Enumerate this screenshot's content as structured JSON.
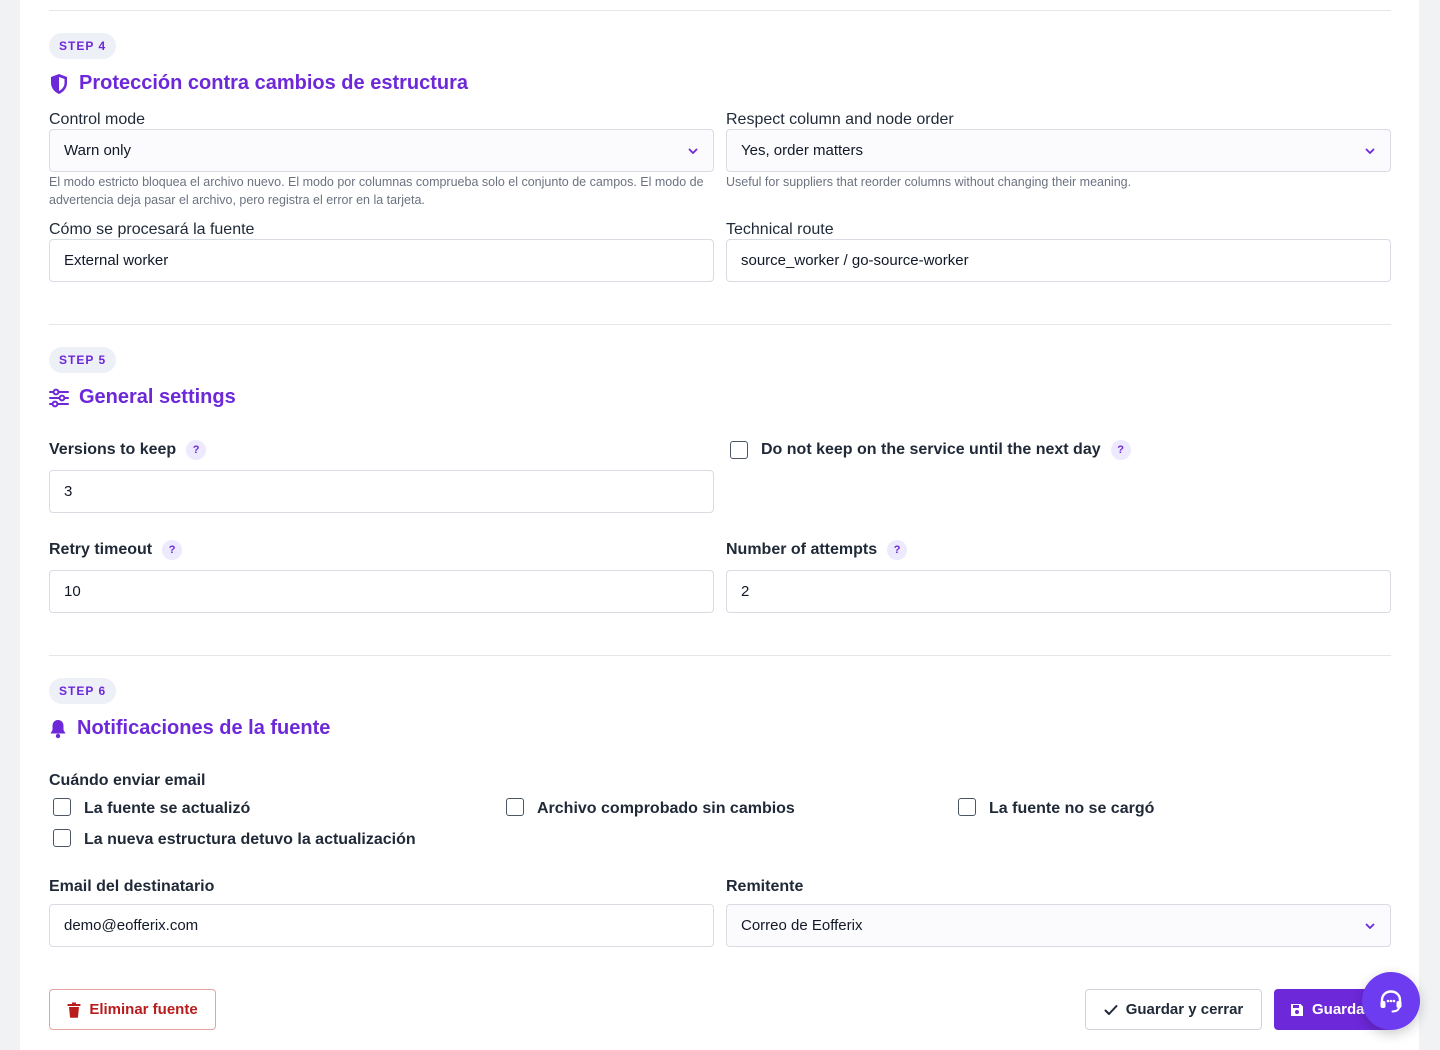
{
  "step4": {
    "pill": "STEP 4",
    "title": "Protección contra cambios de estructura",
    "control_mode": {
      "label": "Control mode",
      "value": "Warn only",
      "help": "El modo estricto bloquea el archivo nuevo. El modo por columnas comprueba solo el conjunto de campos. El modo de advertencia deja pasar el archivo, pero registra el error en la tarjeta."
    },
    "respect_order": {
      "label": "Respect column and node order",
      "value": "Yes, order matters",
      "help": "Useful for suppliers that reorder columns without changing their meaning."
    },
    "processing": {
      "label": "Cómo se procesará la fuente",
      "value": "External worker"
    },
    "technical_route": {
      "label": "Technical route",
      "value": "source_worker / go-source-worker"
    }
  },
  "step5": {
    "pill": "STEP 5",
    "title": "General settings",
    "versions": {
      "label": "Versions to keep",
      "value": "3"
    },
    "do_not_keep": {
      "label": "Do not keep on the service until the next day",
      "checked": false
    },
    "retry_timeout": {
      "label": "Retry timeout",
      "value": "10"
    },
    "attempts": {
      "label": "Number of attempts",
      "value": "2"
    },
    "help_glyph": "?"
  },
  "step6": {
    "pill": "STEP 6",
    "title": "Notificaciones de la fuente",
    "when_label": "Cuándo enviar email",
    "options": [
      {
        "label": "La fuente se actualizó",
        "checked": false
      },
      {
        "label": "Archivo comprobado sin cambios",
        "checked": false
      },
      {
        "label": "La fuente no se cargó",
        "checked": false
      },
      {
        "label": "La nueva estructura detuvo la actualización",
        "checked": false
      }
    ],
    "recipient": {
      "label": "Email del destinatario",
      "value": "demo@eofferix.com"
    },
    "sender": {
      "label": "Remitente",
      "value": "Correo de Eofferix"
    }
  },
  "actions": {
    "delete": "Eliminar fuente",
    "save_close": "Guardar y cerrar",
    "save": "Guardar"
  },
  "colors": {
    "accent": "#6d28d9",
    "danger": "#b91c1c",
    "fab": "#6d3bf0"
  },
  "icons": {
    "step4": "shield-icon",
    "step5": "sliders-icon",
    "step6": "bell-icon",
    "delete": "trash-icon",
    "save_close": "check-icon",
    "save": "floppy-disk-icon",
    "fab": "headset-icon"
  }
}
